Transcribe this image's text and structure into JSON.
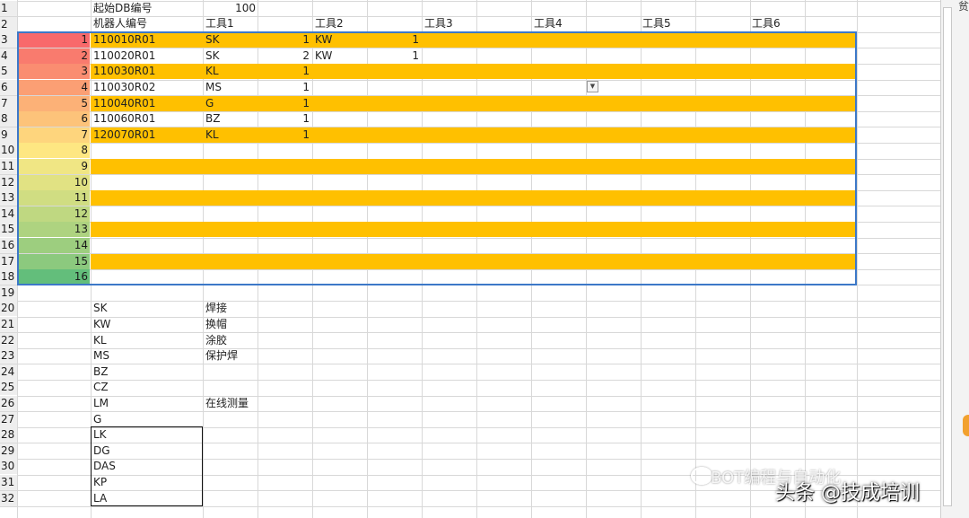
{
  "colors": {
    "band": "#ffc000",
    "border": "#3c78c8",
    "grid": "#d8d8d8"
  },
  "header": {
    "start_db_label": "起始DB编号",
    "start_db_value": "100",
    "robot_id_label": "机器人编号",
    "tools": [
      "工具1",
      "工具2",
      "工具3",
      "工具4",
      "工具5",
      "工具6"
    ]
  },
  "row_numbers": [
    "1",
    "2",
    "3",
    "4",
    "5",
    "6",
    "7",
    "8",
    "9",
    "10",
    "11",
    "12",
    "13",
    "14",
    "15",
    "16",
    "17",
    "18",
    "19",
    "20",
    "21",
    "22",
    "23",
    "24",
    "25",
    "26",
    "27",
    "28",
    "29",
    "30",
    "31",
    "32"
  ],
  "table": {
    "indices": [
      "1",
      "2",
      "3",
      "4",
      "5",
      "6",
      "7",
      "8",
      "9",
      "10",
      "11",
      "12",
      "13",
      "14",
      "15",
      "16"
    ],
    "index_colors": [
      "#f8696b",
      "#f97b6e",
      "#fa8d71",
      "#fb9f74",
      "#fcb177",
      "#fdc37a",
      "#fed57d",
      "#fee782",
      "#f0e684",
      "#e1e283",
      "#d0dd82",
      "#bfd881",
      "#aed380",
      "#9dce7f",
      "#8cc97e",
      "#63be7b"
    ],
    "rows": [
      {
        "robot": "110010R01",
        "t1": "SK",
        "t1n": "1",
        "t2": "KW",
        "t2n": "1"
      },
      {
        "robot": "110020R01",
        "t1": "SK",
        "t1n": "2",
        "t2": "KW",
        "t2n": "1"
      },
      {
        "robot": "110030R01",
        "t1": "KL",
        "t1n": "1",
        "t2": "",
        "t2n": ""
      },
      {
        "robot": "110030R02",
        "t1": "MS",
        "t1n": "1",
        "t2": "",
        "t2n": ""
      },
      {
        "robot": "110040R01",
        "t1": "G",
        "t1n": "1",
        "t2": "",
        "t2n": ""
      },
      {
        "robot": "110060R01",
        "t1": "BZ",
        "t1n": "1",
        "t2": "",
        "t2n": ""
      },
      {
        "robot": "120070R01",
        "t1": "KL",
        "t1n": "1",
        "t2": "",
        "t2n": ""
      }
    ]
  },
  "legend": [
    {
      "code": "SK",
      "desc": "焊接"
    },
    {
      "code": "KW",
      "desc": "换帽"
    },
    {
      "code": "KL",
      "desc": "涂胶"
    },
    {
      "code": "MS",
      "desc": "保护焊"
    },
    {
      "code": "BZ",
      "desc": ""
    },
    {
      "code": "CZ",
      "desc": ""
    },
    {
      "code": "LM",
      "desc": "在线测量"
    },
    {
      "code": "G",
      "desc": ""
    },
    {
      "code": "LK",
      "desc": ""
    },
    {
      "code": "DG",
      "desc": ""
    },
    {
      "code": "DAS",
      "desc": ""
    },
    {
      "code": "KP",
      "desc": ""
    },
    {
      "code": "LA",
      "desc": ""
    }
  ],
  "watermark": "BOT编程与自动化",
  "credit": "头条 @技成培训",
  "side_hint": "贫"
}
